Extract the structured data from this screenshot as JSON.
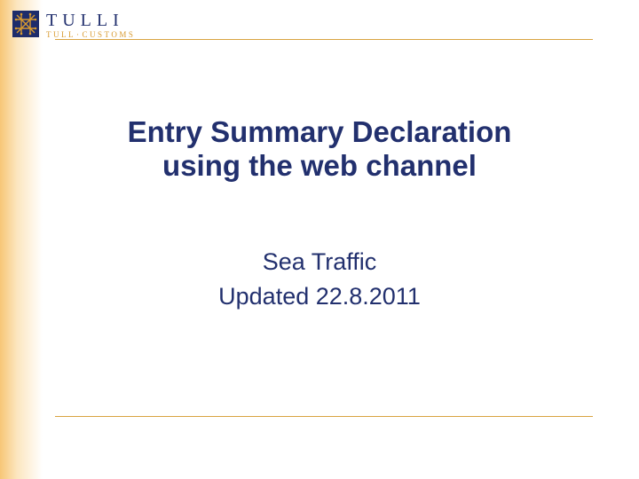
{
  "logo": {
    "main": "TULLI",
    "sub_left": "TULL",
    "sub_right": "CUSTOMS"
  },
  "title": {
    "line1": "Entry Summary Declaration",
    "line2": "using the web channel"
  },
  "subtitle": {
    "line1": "Sea Traffic",
    "line2": "Updated 22.8.2011"
  }
}
